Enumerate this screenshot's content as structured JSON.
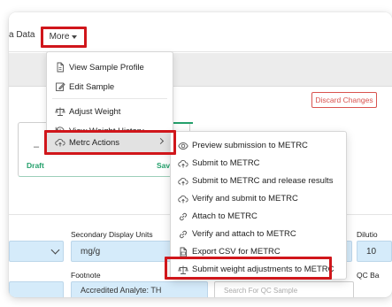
{
  "tabs": {
    "partial_tab_label": "a Data",
    "more_label": "More"
  },
  "actions": {
    "discard_changes_label": "Discard Changes"
  },
  "workflow": {
    "step1_dash": "–",
    "step1_label": "Draft",
    "step2_label": "Sav"
  },
  "form": {
    "secondary_units_label": "Secondary Display Units",
    "secondary_units_value": "mg/g",
    "dilution_label": "Dilutio",
    "dilution_value": "10",
    "footnote_label": "Footnote",
    "footnote_value": "Accredited Analyte: TH",
    "qc_label": "QC Ba",
    "qc_search_placeholder": "Search For QC Sample"
  },
  "more_menu": {
    "items": [
      {
        "label": "View Sample Profile",
        "icon": "document-icon"
      },
      {
        "label": "Edit Sample",
        "icon": "edit-icon"
      },
      {
        "label": "Adjust Weight",
        "icon": "scale-icon"
      },
      {
        "label": "View Weight History",
        "icon": "history-icon"
      },
      {
        "label": "Metrc Actions",
        "icon": "cloud-upload-icon"
      }
    ]
  },
  "metrc_submenu": {
    "items": [
      {
        "label": "Preview submission to METRC",
        "icon": "eye-icon"
      },
      {
        "label": "Submit to METRC",
        "icon": "cloud-upload-icon"
      },
      {
        "label": "Submit to METRC and release results",
        "icon": "cloud-upload-icon"
      },
      {
        "label": "Verify and submit to METRC",
        "icon": "cloud-upload-icon"
      },
      {
        "label": "Attach to METRC",
        "icon": "link-icon"
      },
      {
        "label": "Verify and attach to METRC",
        "icon": "link-icon"
      },
      {
        "label": "Export CSV for METRC",
        "icon": "file-csv-icon"
      },
      {
        "label": "Submit weight adjustments to METRC",
        "icon": "scale-icon"
      }
    ]
  },
  "colors": {
    "highlight": "#d0161b",
    "discard": "#d9534f",
    "success": "#24a06b",
    "field_bg": "#d5ebfa"
  }
}
